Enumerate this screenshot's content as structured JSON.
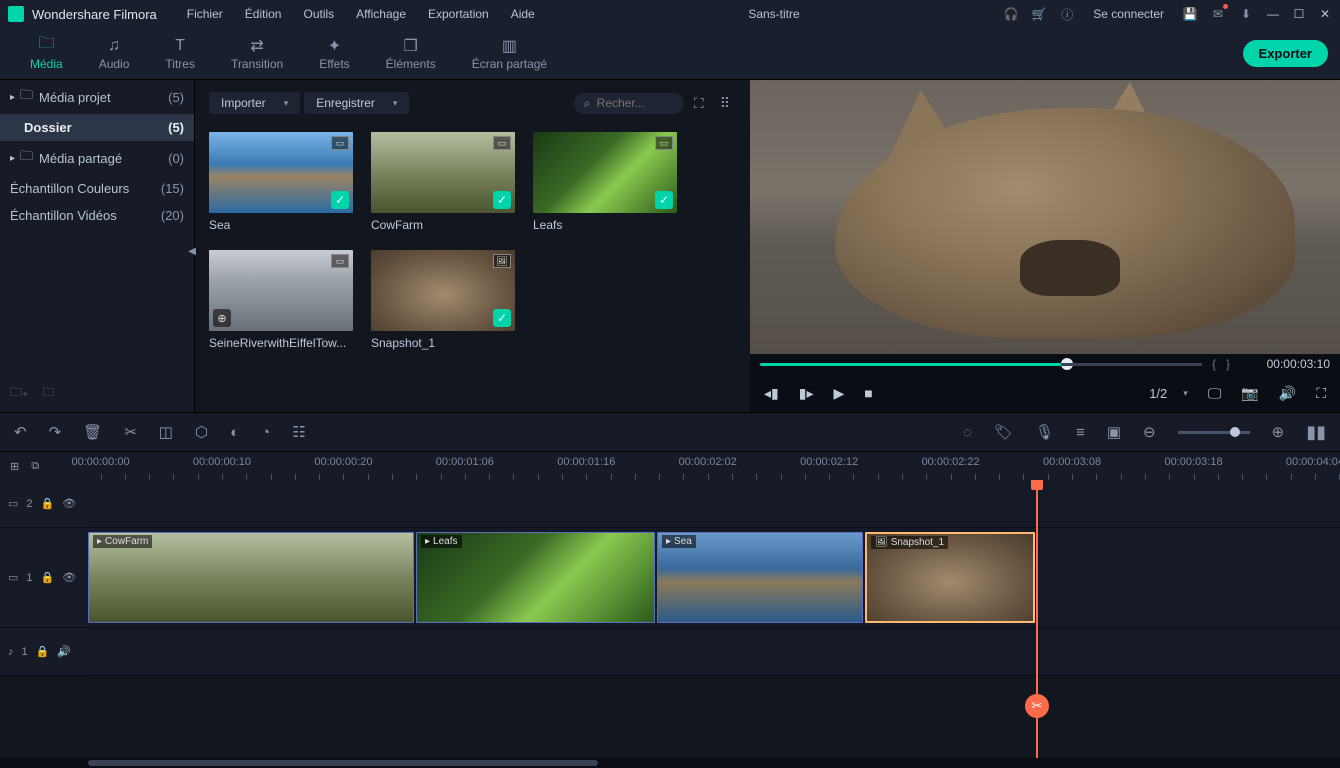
{
  "app": {
    "title": "Wondershare Filmora",
    "doc_title": "Sans-titre",
    "connect": "Se connecter"
  },
  "menu": [
    "Fichier",
    "Édition",
    "Outils",
    "Affichage",
    "Exportation",
    "Aide"
  ],
  "tabs": [
    {
      "label": "Média"
    },
    {
      "label": "Audio"
    },
    {
      "label": "Titres"
    },
    {
      "label": "Transition"
    },
    {
      "label": "Effets"
    },
    {
      "label": "Éléments"
    },
    {
      "label": "Écran partagé"
    }
  ],
  "export_btn": "Exporter",
  "sidebar": {
    "items": [
      {
        "label": "Média projet",
        "count": "(5)"
      },
      {
        "label": "Dossier",
        "count": "(5)"
      },
      {
        "label": "Média partagé",
        "count": "(0)"
      },
      {
        "label": "Échantillon Couleurs",
        "count": "(15)"
      },
      {
        "label": "Échantillon Vidéos",
        "count": "(20)"
      }
    ]
  },
  "media_top": {
    "import": "Importer",
    "save": "Enregistrer",
    "search_placeholder": "Recher..."
  },
  "thumbs": [
    {
      "label": "Sea",
      "cls": "th-sea",
      "checked": true,
      "type": "video"
    },
    {
      "label": "CowFarm",
      "cls": "th-cow",
      "checked": true,
      "type": "video"
    },
    {
      "label": "Leafs",
      "cls": "th-leafs",
      "checked": true,
      "type": "video"
    },
    {
      "label": "SeineRiverwithEiffelTow...",
      "cls": "th-city",
      "checked": false,
      "type": "video",
      "add": true
    },
    {
      "label": "Snapshot_1",
      "cls": "th-snap",
      "checked": true,
      "type": "image"
    }
  ],
  "preview": {
    "timecode": "00:00:03:10",
    "ratio": "1/2"
  },
  "ruler": [
    "00:00:00:00",
    "00:00:00:10",
    "00:00:00:20",
    "00:00:01:06",
    "00:00:01:16",
    "00:00:02:02",
    "00:00:02:12",
    "00:00:02:22",
    "00:00:03:08",
    "00:00:03:18",
    "00:00:04:04"
  ],
  "tracks": {
    "v2": "2",
    "v1": "1",
    "a1": "1"
  },
  "clips": [
    {
      "label": "CowFarm"
    },
    {
      "label": "Leafs"
    },
    {
      "label": "Sea"
    },
    {
      "label": "Snapshot_1"
    }
  ]
}
